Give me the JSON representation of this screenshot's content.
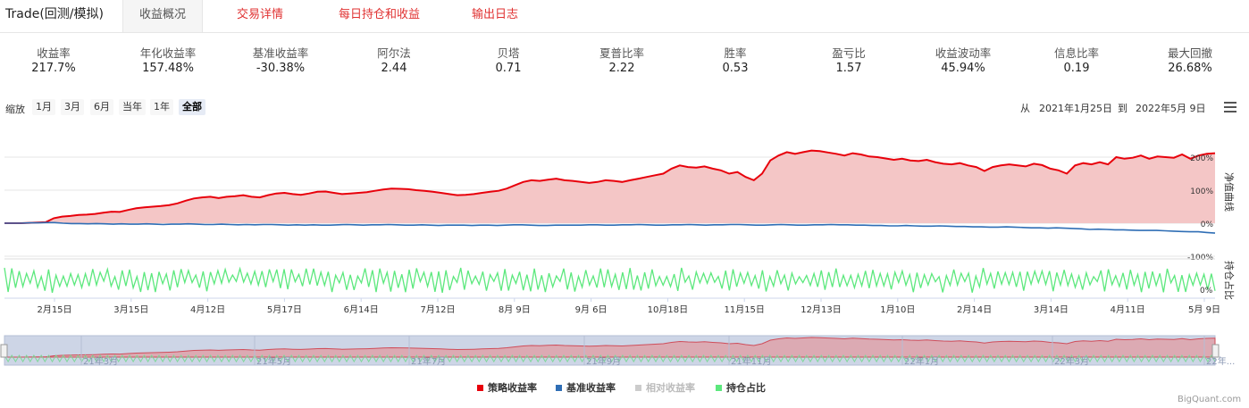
{
  "tabs": {
    "title": "Trade(回测/模拟)",
    "items": [
      "收益概况",
      "交易详情",
      "每日持仓和收益",
      "输出日志"
    ]
  },
  "stats": [
    {
      "label": "收益率",
      "value": "217.7%"
    },
    {
      "label": "年化收益率",
      "value": "157.48%"
    },
    {
      "label": "基准收益率",
      "value": "-30.38%"
    },
    {
      "label": "阿尔法",
      "value": "2.44"
    },
    {
      "label": "贝塔",
      "value": "0.71"
    },
    {
      "label": "夏普比率",
      "value": "2.22"
    },
    {
      "label": "胜率",
      "value": "0.53"
    },
    {
      "label": "盈亏比",
      "value": "1.57"
    },
    {
      "label": "收益波动率",
      "value": "45.94%"
    },
    {
      "label": "信息比率",
      "value": "0.19"
    },
    {
      "label": "最大回撤",
      "value": "26.68%"
    }
  ],
  "zoom": {
    "label": "缩放",
    "buttons": [
      "1月",
      "3月",
      "6月",
      "当年",
      "1年",
      "全部"
    ],
    "selected": "全部"
  },
  "range": {
    "from_label": "从",
    "from": "2021年1月25日",
    "to_label": "到",
    "to": "2022年5月 9日"
  },
  "chart_data": {
    "type": "line",
    "x_start": "2021-01-25",
    "x_end": "2022-05-09",
    "x_tick_labels": [
      "2月15日",
      "3月15日",
      "4月12日",
      "5月17日",
      "6月14日",
      "7月12日",
      "8月 9日",
      "9月 6日",
      "10月18日",
      "11月15日",
      "12月13日",
      "1月10日",
      "2月14日",
      "3月14日",
      "4月11日",
      "5月 9日"
    ],
    "y_axis": {
      "title": "净值曲线",
      "ticks": [
        "200%",
        "100%",
        "0%",
        "-100%"
      ],
      "ylim": [
        -100,
        230
      ]
    },
    "y2_axis": {
      "title": "持仓占比",
      "ticks": [
        "0%"
      ]
    },
    "navigator_labels": [
      "21年3月",
      "21年5月",
      "21年7月",
      "21年9月",
      "21年11月",
      "22年1月",
      "22年3月",
      "22年..."
    ],
    "series": [
      {
        "name": "策略收益率",
        "color": "#e8000b",
        "values": [
          0,
          0,
          0,
          1,
          2,
          3,
          15,
          20,
          22,
          25,
          26,
          28,
          32,
          35,
          34,
          40,
          45,
          48,
          50,
          52,
          55,
          60,
          68,
          75,
          78,
          80,
          76,
          80,
          82,
          85,
          80,
          78,
          85,
          90,
          92,
          88,
          86,
          90,
          95,
          96,
          92,
          88,
          90,
          92,
          94,
          98,
          102,
          105,
          104,
          103,
          100,
          98,
          95,
          92,
          88,
          85,
          86,
          88,
          92,
          95,
          98,
          105,
          115,
          125,
          130,
          128,
          132,
          135,
          130,
          128,
          125,
          122,
          125,
          130,
          128,
          125,
          130,
          135,
          140,
          145,
          150,
          165,
          175,
          170,
          168,
          172,
          165,
          160,
          150,
          155,
          140,
          130,
          150,
          190,
          205,
          215,
          210,
          215,
          220,
          218,
          214,
          210,
          205,
          212,
          208,
          202,
          200,
          196,
          192,
          195,
          190,
          188,
          192,
          185,
          180,
          178,
          182,
          175,
          170,
          158,
          170,
          175,
          178,
          175,
          172,
          180,
          176,
          165,
          160,
          150,
          175,
          182,
          178,
          185,
          178,
          200,
          195,
          198,
          205,
          195,
          202,
          200,
          198,
          208,
          195,
          205,
          210,
          212
        ]
      },
      {
        "name": "基准收益率",
        "color": "#2f6eb5",
        "values": [
          0,
          0,
          0,
          1,
          1,
          2,
          2,
          0,
          -1,
          -1,
          -2,
          -1,
          -2,
          -3,
          -2,
          -3,
          -3,
          -2,
          -3,
          -4,
          -3,
          -3,
          -2,
          -3,
          -4,
          -4,
          -3,
          -4,
          -5,
          -4,
          -5,
          -4,
          -4,
          -5,
          -6,
          -5,
          -6,
          -5,
          -6,
          -6,
          -5,
          -4,
          -5,
          -6,
          -5,
          -5,
          -4,
          -5,
          -6,
          -6,
          -5,
          -6,
          -7,
          -6,
          -6,
          -6,
          -7,
          -6,
          -6,
          -7,
          -6,
          -5,
          -5,
          -6,
          -7,
          -7,
          -6,
          -6,
          -6,
          -6,
          -5,
          -5,
          -6,
          -6,
          -5,
          -5,
          -4,
          -5,
          -6,
          -6,
          -5,
          -5,
          -4,
          -5,
          -6,
          -5,
          -5,
          -4,
          -4,
          -5,
          -6,
          -6,
          -5,
          -4,
          -5,
          -6,
          -6,
          -5,
          -5,
          -4,
          -5,
          -5,
          -6,
          -6,
          -7,
          -7,
          -8,
          -8,
          -7,
          -8,
          -9,
          -9,
          -8,
          -9,
          -10,
          -10,
          -11,
          -11,
          -12,
          -12,
          -11,
          -12,
          -13,
          -14,
          -14,
          -15,
          -14,
          -15,
          -16,
          -17,
          -19,
          -18,
          -19,
          -20,
          -20,
          -21,
          -22,
          -22,
          -22,
          -23,
          -24,
          -25,
          -26,
          -26,
          -28,
          -30
        ]
      },
      {
        "name": "相对收益率",
        "color": "#cccccc",
        "values": []
      },
      {
        "name": "持仓占比",
        "color": "#5ce87d",
        "values": []
      }
    ]
  },
  "brand": "BigQuant.com"
}
